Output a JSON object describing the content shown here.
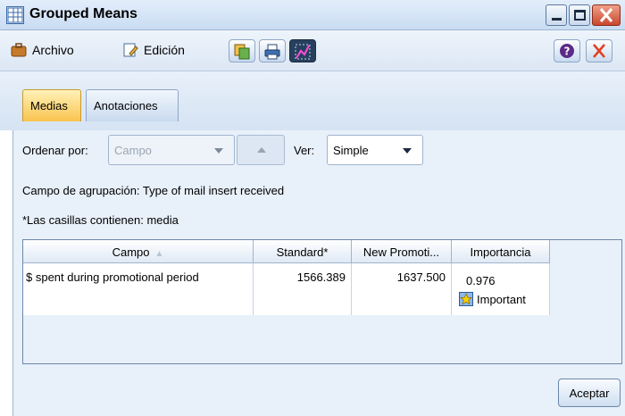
{
  "window": {
    "title": "Grouped Means"
  },
  "menu": {
    "file_label": "Archivo",
    "edit_label": "Edición"
  },
  "tabs": [
    {
      "label": "Medias",
      "active": true
    },
    {
      "label": "Anotaciones",
      "active": false
    }
  ],
  "controls": {
    "sort_label": "Ordenar por:",
    "sort_value": "Campo",
    "view_label": "Ver:",
    "view_value": "Simple"
  },
  "info": {
    "grouping_text": "Campo de agrupación: Type of mail insert received",
    "cells_text": "*Las casillas contienen: media"
  },
  "table": {
    "columns": [
      "Campo",
      "Standard*",
      "New Promoti...",
      "Importancia"
    ],
    "rows": [
      {
        "field": "$ spent during promotional period",
        "standard": "1566.389",
        "new_promo": "1637.500",
        "importance_value": "0.976",
        "importance_label": "Important"
      }
    ]
  },
  "buttons": {
    "accept_label": "Aceptar"
  },
  "colors": {
    "active_tab": "#f9c34e",
    "close_button": "#c9472d",
    "panel_bg": "#e8f0fa"
  }
}
